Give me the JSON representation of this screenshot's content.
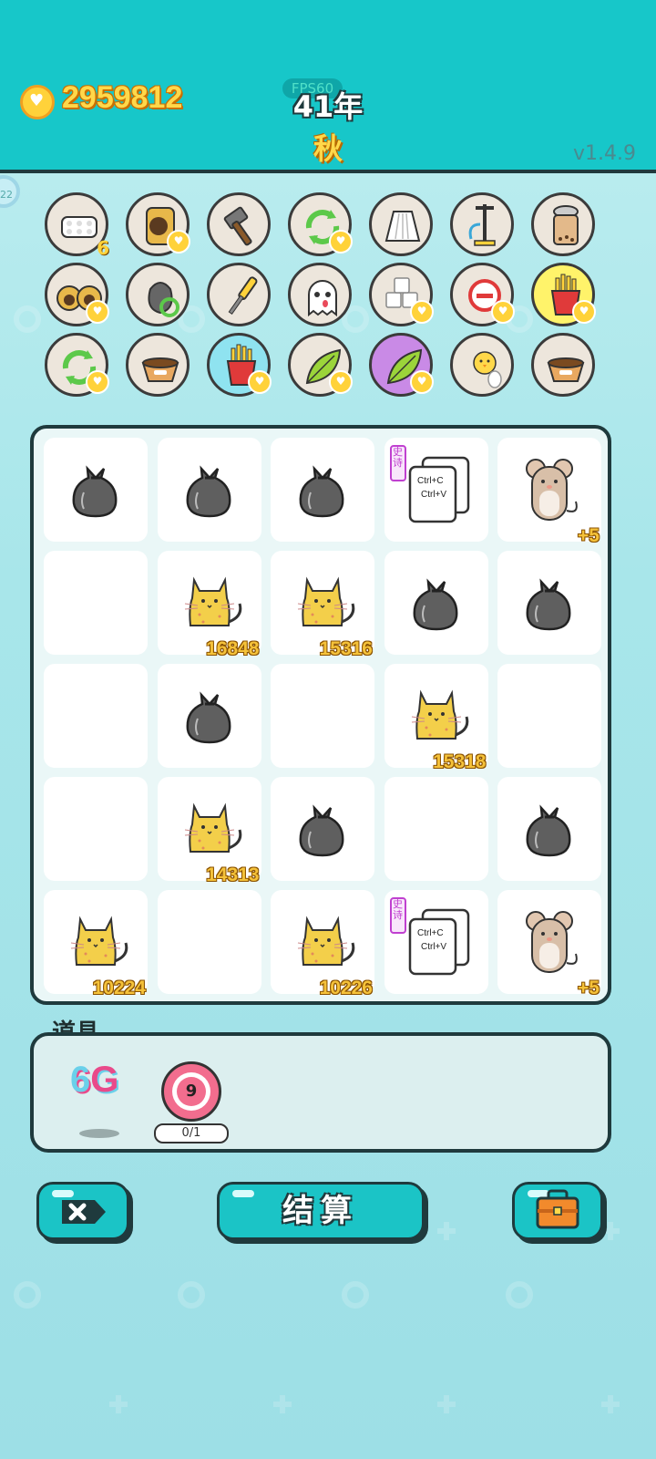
{
  "header": {
    "coins": "2959812",
    "fps": "FPS60",
    "year": "41年",
    "season": "秋",
    "version": "v1.4.9",
    "side_badge": "22"
  },
  "item_icons": [
    {
      "icon": "egg-carton-icon",
      "count": "6"
    },
    {
      "icon": "cat-sack-icon",
      "heart": true
    },
    {
      "icon": "hammer-icon"
    },
    {
      "icon": "recycle-icon",
      "heart": true
    },
    {
      "icon": "skirt-icon"
    },
    {
      "icon": "pump-icon"
    },
    {
      "icon": "milk-tea-icon"
    },
    {
      "icon": "twin-cats-icon",
      "heart": true
    },
    {
      "icon": "recycle-bag-icon"
    },
    {
      "icon": "screwdriver-icon"
    },
    {
      "icon": "ghost-icon"
    },
    {
      "icon": "sugar-cubes-icon",
      "heart": true
    },
    {
      "icon": "remove-icon",
      "heart": true
    },
    {
      "icon": "fries-icon",
      "heart": true,
      "highlight": "#fff36a"
    },
    {
      "icon": "recycle-icon",
      "heart": true
    },
    {
      "icon": "pet-bowl-icon"
    },
    {
      "icon": "fries-icon",
      "heart": true,
      "highlight": "#8fe3f0"
    },
    {
      "icon": "leaf-icon",
      "heart": true
    },
    {
      "icon": "leaf-icon",
      "heart": true,
      "highlight": "#c98ae6"
    },
    {
      "icon": "chick-egg-icon"
    },
    {
      "icon": "pet-bowl-icon"
    }
  ],
  "grid": [
    [
      {
        "type": "trash-bag"
      },
      {
        "type": "trash-bag"
      },
      {
        "type": "trash-bag"
      },
      {
        "type": "copy-paste",
        "tag": "史诗",
        "line1": "Ctrl+C",
        "line2": "Ctrl+V"
      },
      {
        "type": "mouse",
        "value": "+5"
      }
    ],
    [
      {
        "type": "empty"
      },
      {
        "type": "cat",
        "value": "16848"
      },
      {
        "type": "cat",
        "value": "15316"
      },
      {
        "type": "trash-bag"
      },
      {
        "type": "trash-bag"
      }
    ],
    [
      {
        "type": "empty"
      },
      {
        "type": "trash-bag"
      },
      {
        "type": "empty"
      },
      {
        "type": "cat",
        "value": "15318"
      },
      {
        "type": "empty"
      }
    ],
    [
      {
        "type": "empty"
      },
      {
        "type": "cat",
        "value": "14313"
      },
      {
        "type": "trash-bag"
      },
      {
        "type": "empty"
      },
      {
        "type": "trash-bag"
      }
    ],
    [
      {
        "type": "cat",
        "value": "10224"
      },
      {
        "type": "empty"
      },
      {
        "type": "cat",
        "value": "10226"
      },
      {
        "type": "copy-paste",
        "tag": "史诗",
        "line1": "Ctrl+C",
        "line2": "Ctrl+V"
      },
      {
        "type": "mouse",
        "value": "+5"
      }
    ]
  ],
  "props": {
    "label": "道具",
    "g6_a": "6",
    "g6_b": "G",
    "target_number": "9",
    "target_count": "0/1"
  },
  "buttons": {
    "settle": "结算"
  },
  "colors": {
    "header": "#17c7c9",
    "coin_text": "#ffd84a",
    "button": "#1bc4c6",
    "outline": "#1f3a3d"
  }
}
